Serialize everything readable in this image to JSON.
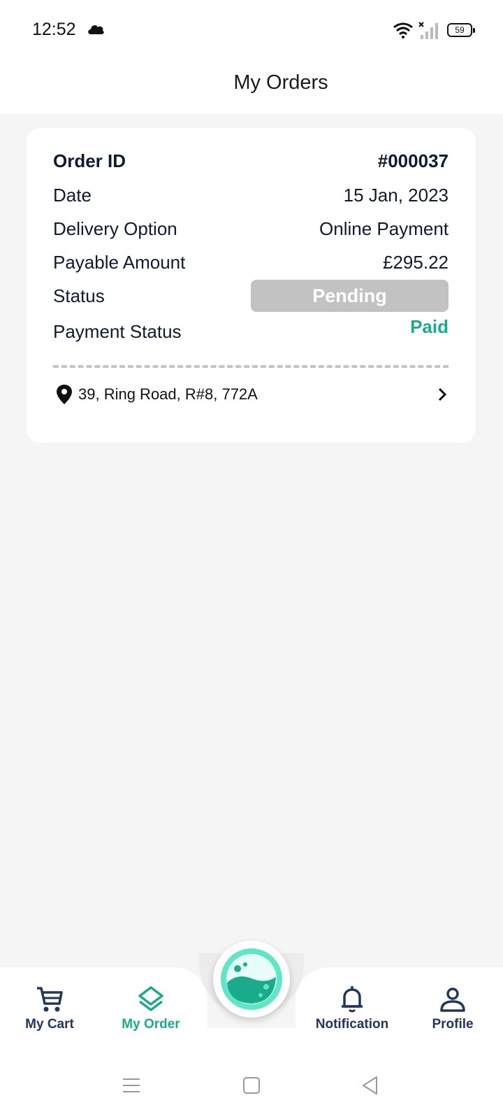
{
  "status_bar": {
    "time": "12:52",
    "battery": "59",
    "icons": [
      "cloud-icon",
      "wifi-icon",
      "signal-icon",
      "battery-icon"
    ]
  },
  "header": {
    "title": "My Orders"
  },
  "order": {
    "id_label": "Order ID",
    "id_value": "#000037",
    "date_label": "Date",
    "date_value": "15 Jan, 2023",
    "delivery_label": "Delivery Option",
    "delivery_value": "Online Payment",
    "amount_label": "Payable Amount",
    "amount_value": "£295.22",
    "status_label": "Status",
    "status_value": "Pending",
    "payment_status_label": "Payment Status",
    "payment_status_value": "Paid",
    "address": "39, Ring Road, R#8, 772A"
  },
  "colors": {
    "accent": "#1aab8b",
    "nav_text": "#22375a",
    "pending": "#c2c2c2",
    "background": "#f5f5f5"
  },
  "bottom_nav": {
    "items": [
      {
        "label": "My Cart",
        "icon": "cart-icon",
        "active": false
      },
      {
        "label": "My Order",
        "icon": "layers-icon",
        "active": true
      },
      {
        "label": "Notification",
        "icon": "bell-icon",
        "active": false
      },
      {
        "label": "Profile",
        "icon": "user-icon",
        "active": false
      }
    ],
    "center_icon": "laundry-logo-icon"
  },
  "system_nav": {
    "icons": [
      "menu-icon",
      "home-square-icon",
      "back-triangle-icon"
    ]
  }
}
